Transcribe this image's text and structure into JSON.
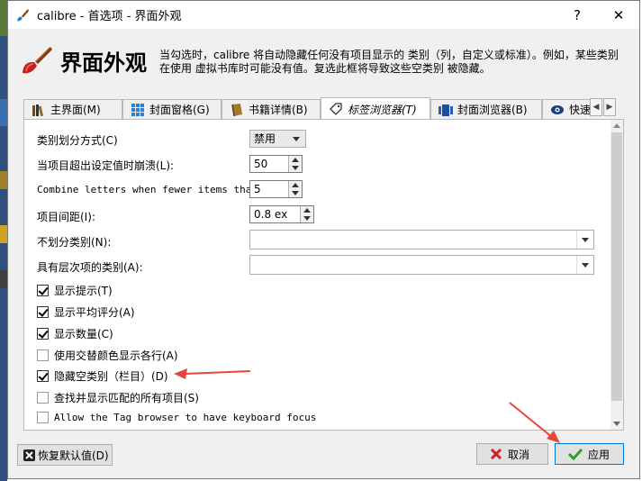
{
  "window": {
    "title": "calibre - 首选项 - 界面外观"
  },
  "header": {
    "title": "界面外观",
    "description": "当勾选时，calibre 将自动隐藏任何没有项目显示的 类别（列，自定义或标准）。例如，某些类别在使用 虚拟书库时可能没有值。复选此框将导致这些空类别 被隐藏。"
  },
  "tabs": [
    {
      "label": "主界面(M)",
      "icon": "library-books-icon"
    },
    {
      "label": "封面窗格(G)",
      "icon": "grid-icon"
    },
    {
      "label": "书籍详情(B)",
      "icon": "book-icon"
    },
    {
      "label": "标签浏览器(T)",
      "icon": "tag-icon",
      "active": true
    },
    {
      "label": "封面浏览器(B)",
      "icon": "cover-browser-icon"
    },
    {
      "label": "快速查",
      "icon": "eye-icon"
    }
  ],
  "settings": {
    "category_partition_label": "类别划分方式(C)",
    "category_partition_value": "禁用",
    "collapse_label": "当项目超出设定值时崩溃(L):",
    "collapse_value": "50",
    "combine_label": "Combine letters when fewer items than:",
    "combine_value": "5",
    "spacing_label": "项目间距(I):",
    "spacing_value": "0.8 ex",
    "no_partition_label": "不划分类别(N):",
    "no_partition_value": "",
    "hierarchy_label": "具有层次项的类别(A):",
    "hierarchy_value": ""
  },
  "checkboxes": [
    {
      "label": "显示提示(T)",
      "checked": true
    },
    {
      "label": "显示平均评分(A)",
      "checked": true
    },
    {
      "label": "显示数量(C)",
      "checked": true
    },
    {
      "label": "使用交替颜色显示各行(A)",
      "checked": false
    },
    {
      "label": "隐藏空类别（栏目）(D)",
      "checked": true
    },
    {
      "label": "查找并显示匹配的所有项目(S)",
      "checked": false
    },
    {
      "label": "Allow the Tag browser to have keyboard focus",
      "checked": false
    }
  ],
  "buttons": {
    "restore_defaults": "恢复默认值(D)",
    "cancel": "取消",
    "apply": "应用"
  },
  "colors": {
    "annotation_arrow": "#e8453c",
    "accent": "#0078d7"
  }
}
